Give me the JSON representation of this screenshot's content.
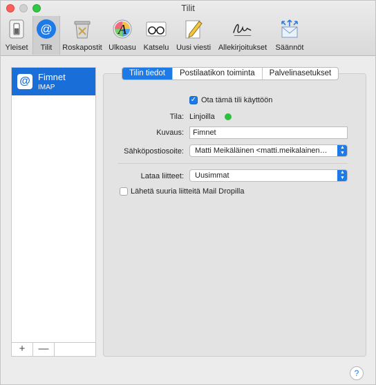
{
  "window": {
    "title": "Tilit"
  },
  "toolbar": {
    "items": [
      {
        "label": "Yleiset",
        "icon": "switch-icon"
      },
      {
        "label": "Tilit",
        "icon": "at-icon",
        "selected": true
      },
      {
        "label": "Roskapostit",
        "icon": "trash-icon"
      },
      {
        "label": "Ulkoasu",
        "icon": "font-icon"
      },
      {
        "label": "Katselu",
        "icon": "glasses-icon"
      },
      {
        "label": "Uusi viesti",
        "icon": "pencil-icon"
      },
      {
        "label": "Allekirjoitukset",
        "icon": "signature-icon"
      },
      {
        "label": "Säännöt",
        "icon": "rules-icon"
      }
    ]
  },
  "sidebar": {
    "account": {
      "name": "Fimnet",
      "type": "IMAP",
      "icon": "at-icon"
    },
    "add_label": "+",
    "remove_label": "—"
  },
  "tabs": [
    {
      "label": "Tilin tiedot",
      "active": true
    },
    {
      "label": "Postilaatikon toiminta"
    },
    {
      "label": "Palvelinasetukset"
    }
  ],
  "form": {
    "enable_label": "Ota tämä tili käyttöön",
    "enable_checked": true,
    "status_label": "Tila:",
    "status_value": "Linjoilla",
    "status_color": "#2fc040",
    "description_label": "Kuvaus:",
    "description_value": "Fimnet",
    "email_label": "Sähköpostiosoite:",
    "email_value": "Matti Meikäläinen <matti.meikalainen…",
    "download_label": "Lataa liitteet:",
    "download_value": "Uusimmat",
    "dropmail_label": "Lähetä suuria liitteitä Mail Dropilla",
    "dropmail_checked": false
  },
  "help_label": "?",
  "colors": {
    "accent": "#1d7ae6",
    "selection": "#1a6ed8"
  }
}
